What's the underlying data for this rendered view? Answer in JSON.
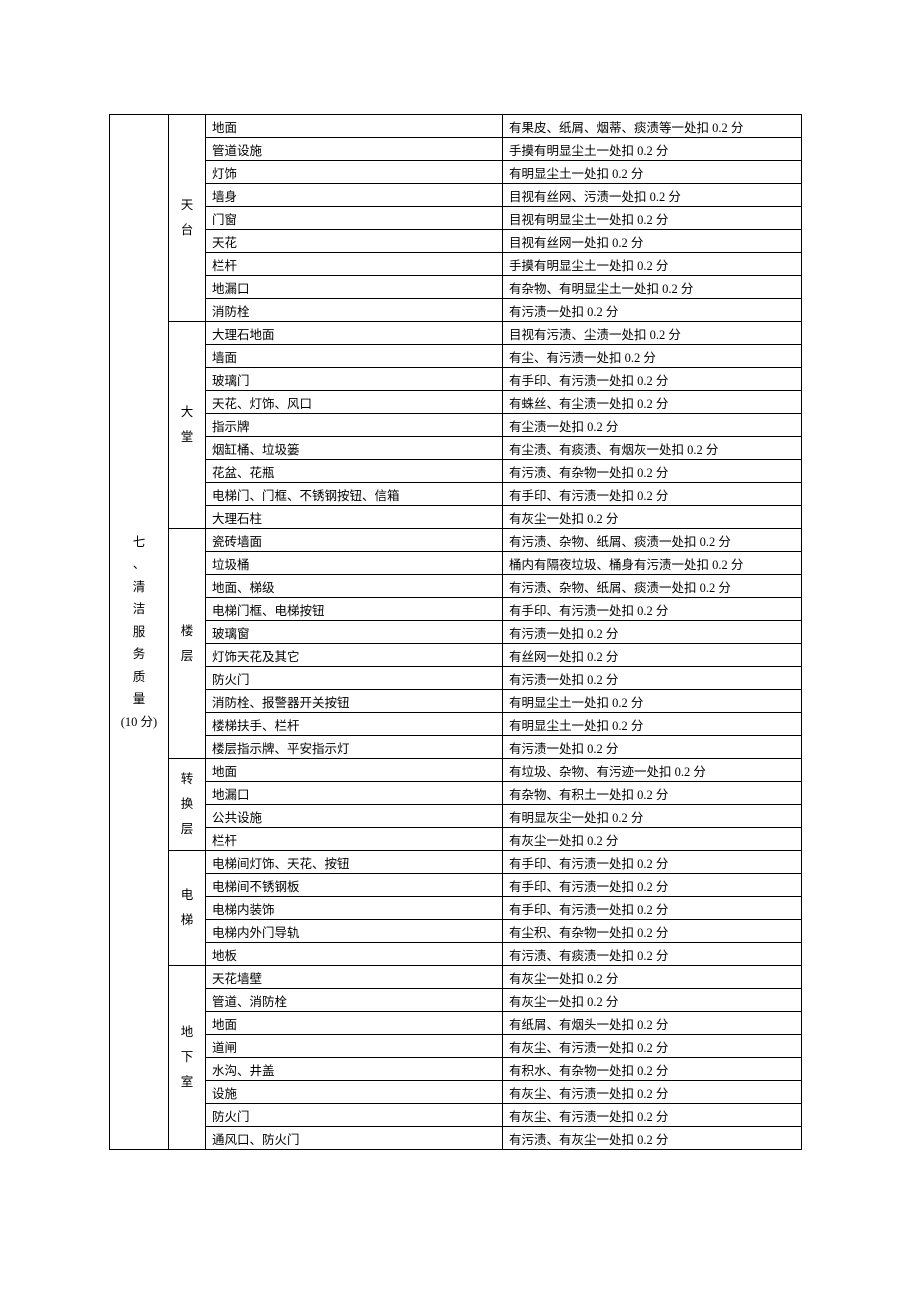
{
  "col1": {
    "title": "七、清洁服务质量",
    "score": "(10 分)"
  },
  "groups": [
    {
      "name": "天台",
      "rows": [
        {
          "a": "地面",
          "b": "有果皮、纸屑、烟蒂、痰渍等一处扣 0.2 分"
        },
        {
          "a": "管道设施",
          "b": "手摸有明显尘土一处扣 0.2 分"
        },
        {
          "a": "灯饰",
          "b": "有明显尘土一处扣 0.2 分"
        },
        {
          "a": "墙身",
          "b": "目视有丝网、污渍一处扣 0.2 分"
        },
        {
          "a": "门窗",
          "b": "目视有明显尘土一处扣 0.2 分"
        },
        {
          "a": "天花",
          "b": "目视有丝网一处扣 0.2 分"
        },
        {
          "a": "栏杆",
          "b": "手摸有明显尘土一处扣 0.2 分"
        },
        {
          "a": "地漏口",
          "b": "有杂物、有明显尘土一处扣 0.2 分"
        },
        {
          "a": "消防栓",
          "b": "有污渍一处扣 0.2 分"
        }
      ]
    },
    {
      "name": "大堂",
      "rows": [
        {
          "a": "大理石地面",
          "b": "目视有污渍、尘渍一处扣 0.2 分"
        },
        {
          "a": "墙面",
          "b": "有尘、有污渍一处扣 0.2 分"
        },
        {
          "a": "玻璃门",
          "b": "有手印、有污渍一处扣 0.2 分"
        },
        {
          "a": "天花、灯饰、风口",
          "b": "有蛛丝、有尘渍一处扣 0.2 分"
        },
        {
          "a": "指示牌",
          "b": "有尘渍一处扣 0.2 分"
        },
        {
          "a": "烟缸桶、垃圾篓",
          "b": "有尘渍、有痰渍、有烟灰一处扣 0.2 分"
        },
        {
          "a": "花盆、花瓶",
          "b": "有污渍、有杂物一处扣 0.2 分"
        },
        {
          "a": "电梯门、门框、不锈钢按钮、信箱",
          "b": "有手印、有污渍一处扣 0.2 分"
        },
        {
          "a": "大理石柱",
          "b": "有灰尘一处扣 0.2 分"
        }
      ]
    },
    {
      "name": "楼层",
      "rows": [
        {
          "a": "瓷砖墙面",
          "b": "有污渍、杂物、纸屑、痰渍一处扣 0.2 分"
        },
        {
          "a": "垃圾桶",
          "b": "桶内有隔夜垃圾、桶身有污渍一处扣 0.2 分"
        },
        {
          "a": "地面、梯级",
          "b": "有污渍、杂物、纸屑、痰渍一处扣 0.2 分"
        },
        {
          "a": "电梯门框、电梯按钮",
          "b": "有手印、有污渍一处扣 0.2 分"
        },
        {
          "a": "玻璃窗",
          "b": "有污渍一处扣 0.2 分"
        },
        {
          "a": "灯饰天花及其它",
          "b": "有丝网一处扣 0.2 分"
        },
        {
          "a": "防火门",
          "b": "有污渍一处扣 0.2 分"
        },
        {
          "a": "消防栓、报警器开关按钮",
          "b": "有明显尘土一处扣 0.2 分"
        },
        {
          "a": "楼梯扶手、栏杆",
          "b": "有明显尘土一处扣 0.2 分"
        },
        {
          "a": "楼层指示牌、平安指示灯",
          "b": "有污渍一处扣 0.2 分"
        }
      ]
    },
    {
      "name": "转换层",
      "rows": [
        {
          "a": "地面",
          "b": "有垃圾、杂物、有污迹一处扣 0.2 分"
        },
        {
          "a": "地漏口",
          "b": "有杂物、有积土一处扣 0.2 分"
        },
        {
          "a": "公共设施",
          "b": "有明显灰尘一处扣 0.2 分"
        },
        {
          "a": "栏杆",
          "b": "有灰尘一处扣 0.2 分"
        }
      ]
    },
    {
      "name": "电梯",
      "rows": [
        {
          "a": "电梯间灯饰、天花、按钮",
          "b": "有手印、有污渍一处扣 0.2 分"
        },
        {
          "a": "电梯间不锈钢板",
          "b": "有手印、有污渍一处扣 0.2 分"
        },
        {
          "a": "电梯内装饰",
          "b": "有手印、有污渍一处扣 0.2 分"
        },
        {
          "a": "电梯内外门导轨",
          "b": "有尘积、有杂物一处扣 0.2 分"
        },
        {
          "a": "地板",
          "b": "有污渍、有痰渍一处扣 0.2 分"
        }
      ]
    },
    {
      "name": "地下室",
      "rows": [
        {
          "a": "天花墙壁",
          "b": "有灰尘一处扣 0.2 分"
        },
        {
          "a": "管道、消防栓",
          "b": "有灰尘一处扣 0.2 分"
        },
        {
          "a": "地面",
          "b": "有纸屑、有烟头一处扣 0.2 分"
        },
        {
          "a": "道闸",
          "b": "有灰尘、有污渍一处扣 0.2 分"
        },
        {
          "a": "水沟、井盖",
          "b": "有积水、有杂物一处扣 0.2 分"
        },
        {
          "a": "设施",
          "b": "有灰尘、有污渍一处扣 0.2 分"
        },
        {
          "a": "防火门",
          "b": "有灰尘、有污渍一处扣 0.2 分"
        },
        {
          "a": "通风口、防火门",
          "b": "有污渍、有灰尘一处扣 0.2 分"
        }
      ]
    }
  ]
}
